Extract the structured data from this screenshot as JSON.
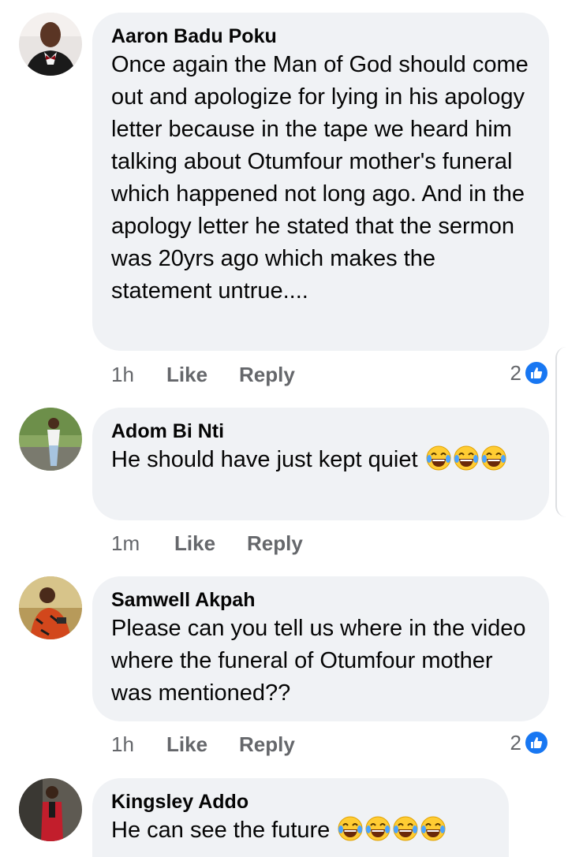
{
  "comments": [
    {
      "author": "Aaron Badu Poku",
      "text": "Once again the Man of God should come out and apologize for lying in his apology letter because in the tape we heard him talking about Otumfour mother's funeral which happened not long ago. And in the apology letter he stated that the sermon was 20yrs ago which makes the statement untrue....",
      "time": "1h",
      "like_label": "Like",
      "reply_label": "Reply",
      "reaction_count": "2"
    },
    {
      "author": "Adom Bi Nti",
      "text": "He should have just kept quiet",
      "time": "1m",
      "like_label": "Like",
      "reply_label": "Reply",
      "emoji_count": 3
    },
    {
      "author": "Samwell Akpah",
      "text": "Please can you tell us where in the video where the funeral of Otumfour mother was mentioned??",
      "time": "1h",
      "like_label": "Like",
      "reply_label": "Reply",
      "reaction_count": "2"
    },
    {
      "author": "Kingsley Addo",
      "text": "He can see the future",
      "emoji_count": 4
    }
  ],
  "icons": {
    "emoji": "tears-of-joy-emoji",
    "reaction": "thumbs-up-icon",
    "reaction_color": "#1877f2"
  }
}
